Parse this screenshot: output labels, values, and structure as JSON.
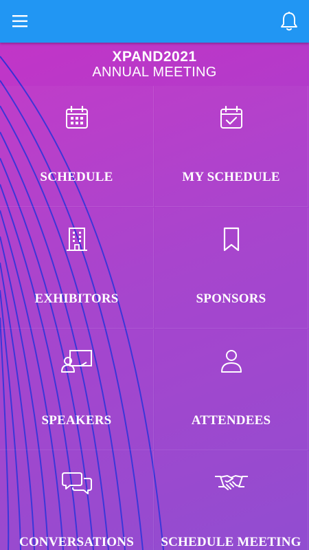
{
  "topbar": {
    "menu_icon": "hamburger-icon",
    "notification_icon": "bell-icon",
    "bg": "#2196f3"
  },
  "header": {
    "title": "XPAND2021",
    "subtitle": "ANNUAL MEETING"
  },
  "tiles": [
    {
      "label": "SCHEDULE",
      "icon": "calendar-icon"
    },
    {
      "label": "MY SCHEDULE",
      "icon": "calendar-check-icon"
    },
    {
      "label": "EXHIBITORS",
      "icon": "building-icon"
    },
    {
      "label": "SPONSORS",
      "icon": "bookmark-icon"
    },
    {
      "label": "SPEAKERS",
      "icon": "presenter-icon"
    },
    {
      "label": "ATTENDEES",
      "icon": "person-icon"
    },
    {
      "label": "CONVERSATIONS",
      "icon": "chat-bubbles-icon"
    },
    {
      "label": "SCHEDULE MEETING",
      "icon": "handshake-icon"
    }
  ],
  "colors": {
    "gradient_start": "#c235c7",
    "gradient_end": "#8e48cf",
    "curve_lines": "#2a2fd8"
  }
}
